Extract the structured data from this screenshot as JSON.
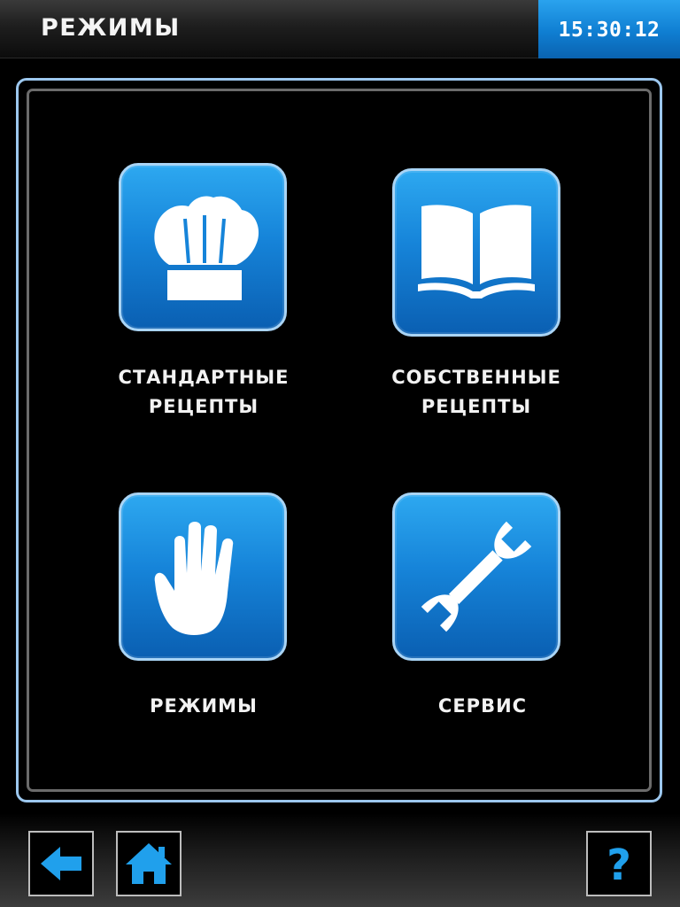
{
  "header": {
    "title": "РЕЖИМЫ",
    "time": "15:30:12"
  },
  "tiles": [
    {
      "icon": "chef-hat-icon",
      "label_line1": "СТАНДАРТНЫЕ",
      "label_line2": "РЕЦЕПТЫ"
    },
    {
      "icon": "open-book-icon",
      "label_line1": "СОБСТВЕННЫЕ",
      "label_line2": "РЕЦЕПТЫ"
    },
    {
      "icon": "hand-icon",
      "label_line1": "РЕЖИМЫ"
    },
    {
      "icon": "wrench-icon",
      "label_line1": "СЕРВИС"
    }
  ],
  "nav": {
    "back_icon": "back-arrow-icon",
    "home_icon": "home-icon",
    "help_icon": "help-icon",
    "help_symbol": "?"
  },
  "colors": {
    "accent": "#1684d9",
    "tile_border": "#a9d4f5",
    "frame_border": "#9cc7ee",
    "icon_blue": "#20a0ec"
  }
}
